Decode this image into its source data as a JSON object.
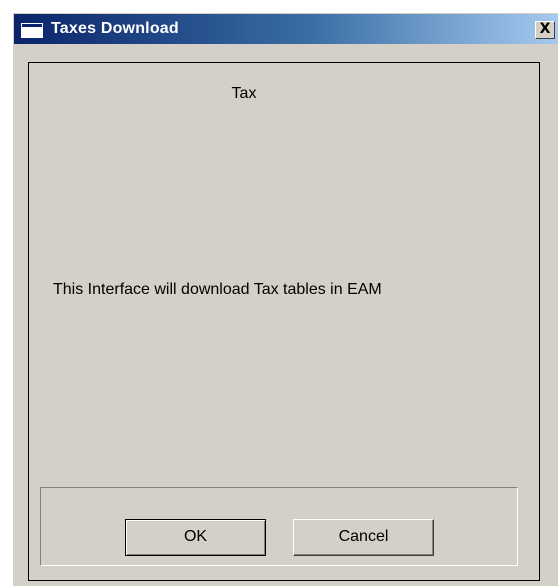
{
  "window": {
    "title": "Taxes Download",
    "close_label": "X"
  },
  "content": {
    "heading": "Tax",
    "message": "This Interface will download Tax tables in EAM"
  },
  "buttons": {
    "ok_label": "OK",
    "cancel_label": "Cancel"
  },
  "colors": {
    "titlebar_start": "#0a246a",
    "titlebar_end": "#a6caf0",
    "face": "#d4d0c8"
  }
}
